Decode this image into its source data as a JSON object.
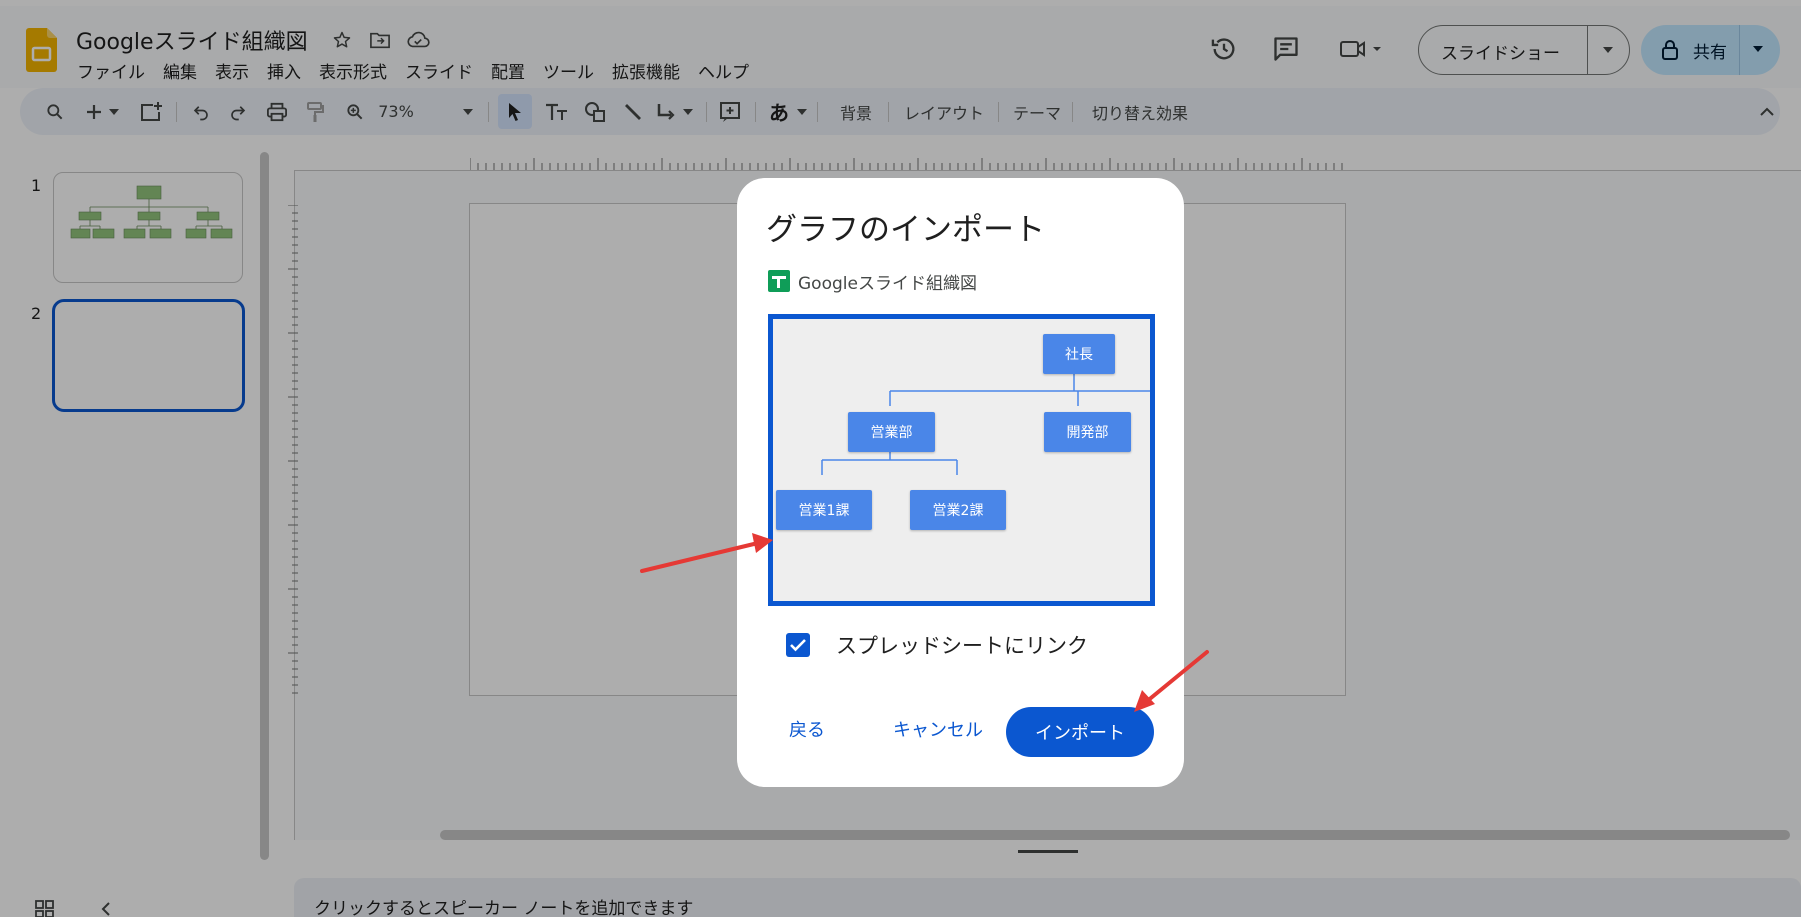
{
  "app": {
    "doc_title": "Googleスライド組織図",
    "menu": [
      "ファイル",
      "編集",
      "表示",
      "挿入",
      "表示形式",
      "スライド",
      "配置",
      "ツール",
      "拡張機能",
      "ヘルプ"
    ],
    "slideshow_label": "スライドショー",
    "share_label": "共有"
  },
  "toolbar": {
    "zoom": "73%",
    "input_tool": "あ",
    "background": "背景",
    "layout": "レイアウト",
    "theme": "テーマ",
    "transition": "切り替え効果"
  },
  "filmstrip": {
    "slides": [
      {
        "number": "1"
      },
      {
        "number": "2"
      }
    ]
  },
  "notes": {
    "placeholder": "クリックするとスピーカー ノートを追加できます"
  },
  "dialog": {
    "title": "グラフのインポート",
    "source_name": "Googleスライド組織図",
    "chart_nodes": {
      "root": "社長",
      "sales": "営業部",
      "dev": "開発部",
      "sales1": "営業1課",
      "sales2": "営業2課"
    },
    "link_checkbox_label": "スプレッドシートにリンク",
    "link_checked": true,
    "back_label": "戻る",
    "cancel_label": "キャンセル",
    "import_label": "インポート"
  },
  "colors": {
    "accent": "#0b57d0",
    "node": "#4a86e8",
    "annotation_arrow": "#e53935"
  }
}
